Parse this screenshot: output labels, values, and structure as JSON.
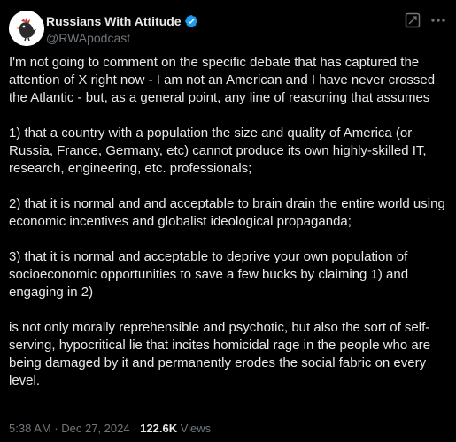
{
  "author": {
    "display_name": "Russians With Attitude",
    "handle": "@RWApodcast",
    "verified": true
  },
  "tweet": {
    "paragraphs": [
      "I'm not going to comment on the specific debate that has captured the attention of X right now - I am not an American and I have never crossed the Atlantic - but, as a general point, any line of reasoning that assumes",
      "1) that a country with a population the size and quality of America (or Russia, France, Germany, etc) cannot produce its own highly-skilled IT, research, engineering, etc. professionals;",
      "2) that it is normal and and acceptable to brain drain the entire world using economic incentives and globalist ideological propaganda;",
      "3) that it is normal and acceptable to deprive your own population of socioeconomic opportunities to save a few bucks by claiming 1) and engaging in 2)",
      "is not only morally reprehensible and psychotic, but also the sort of self-serving, hypocritical lie that incites homicidal rage in the people who are being damaged by it and permanently erodes the social fabric on every level."
    ]
  },
  "meta": {
    "time": "5:38 AM",
    "separator": " · ",
    "date": "Dec 27, 2024",
    "views_count": "122.6K",
    "views_label": " Views"
  },
  "icons": {
    "grok": "grok-icon",
    "more": "more-options-icon",
    "verified": "verified-badge-icon",
    "avatar": "rooster-logo"
  },
  "colors": {
    "background": "#000000",
    "text": "#e7e9ea",
    "secondary": "#71767b",
    "verified": "#1d9bf0"
  }
}
